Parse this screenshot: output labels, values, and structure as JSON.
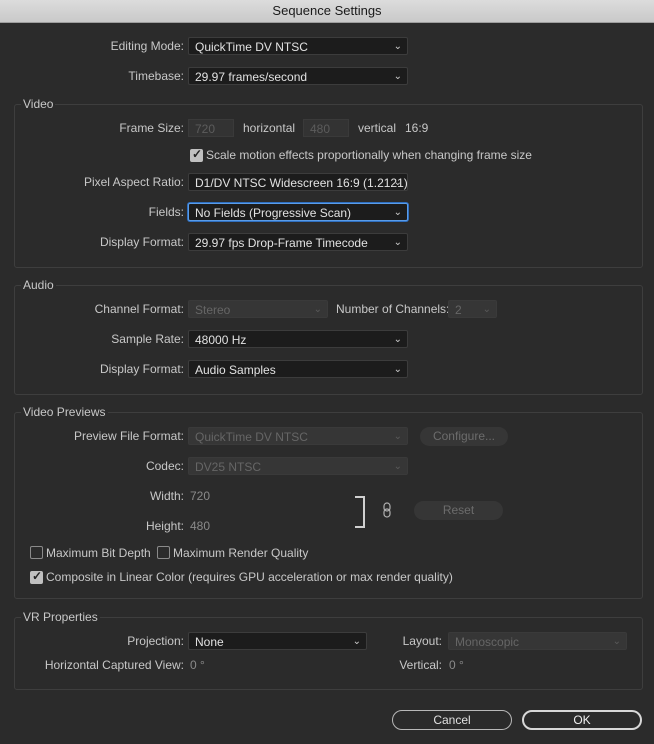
{
  "window": {
    "title": "Sequence Settings"
  },
  "editing_mode": {
    "label": "Editing Mode:",
    "value": "QuickTime DV NTSC"
  },
  "timebase": {
    "label": "Timebase:",
    "value": "29.97  frames/second"
  },
  "video": {
    "title": "Video",
    "frame_size_label": "Frame Size:",
    "width_value": "720",
    "horizontal_label": "horizontal",
    "height_value": "480",
    "vertical_label": "vertical",
    "aspect_text": "16:9",
    "scale_motion_label": "Scale motion effects proportionally when changing frame size",
    "scale_motion_checked": true,
    "pixel_aspect_label": "Pixel Aspect Ratio:",
    "pixel_aspect_value": "D1/DV NTSC Widescreen 16:9 (1.2121)",
    "fields_label": "Fields:",
    "fields_value": "No Fields (Progressive Scan)",
    "display_format_label": "Display Format:",
    "display_format_value": "29.97 fps Drop-Frame Timecode"
  },
  "audio": {
    "title": "Audio",
    "channel_format_label": "Channel Format:",
    "channel_format_value": "Stereo",
    "num_channels_label": "Number of Channels:",
    "num_channels_value": "2",
    "sample_rate_label": "Sample Rate:",
    "sample_rate_value": "48000 Hz",
    "display_format_label": "Display Format:",
    "display_format_value": "Audio Samples"
  },
  "previews": {
    "title": "Video Previews",
    "file_format_label": "Preview File Format:",
    "file_format_value": "QuickTime DV NTSC",
    "configure_label": "Configure...",
    "codec_label": "Codec:",
    "codec_value": "DV25 NTSC",
    "width_label": "Width:",
    "width_value": "720",
    "height_label": "Height:",
    "height_value": "480",
    "reset_label": "Reset",
    "max_bit_depth_label": "Maximum Bit Depth",
    "max_bit_depth_checked": false,
    "max_render_label": "Maximum Render Quality",
    "max_render_checked": false,
    "linear_color_label": "Composite in Linear Color (requires GPU acceleration or max render quality)",
    "linear_color_checked": true
  },
  "vr": {
    "title": "VR Properties",
    "projection_label": "Projection:",
    "projection_value": "None",
    "layout_label": "Layout:",
    "layout_value": "Monoscopic",
    "h_view_label": "Horizontal Captured View:",
    "h_view_value": "0 °",
    "vertical_label": "Vertical:",
    "vertical_value": "0 °"
  },
  "buttons": {
    "cancel": "Cancel",
    "ok": "OK"
  },
  "icons": {
    "chevron": "chevron-down-icon",
    "link": "link-icon",
    "check": "checkmark-icon"
  }
}
